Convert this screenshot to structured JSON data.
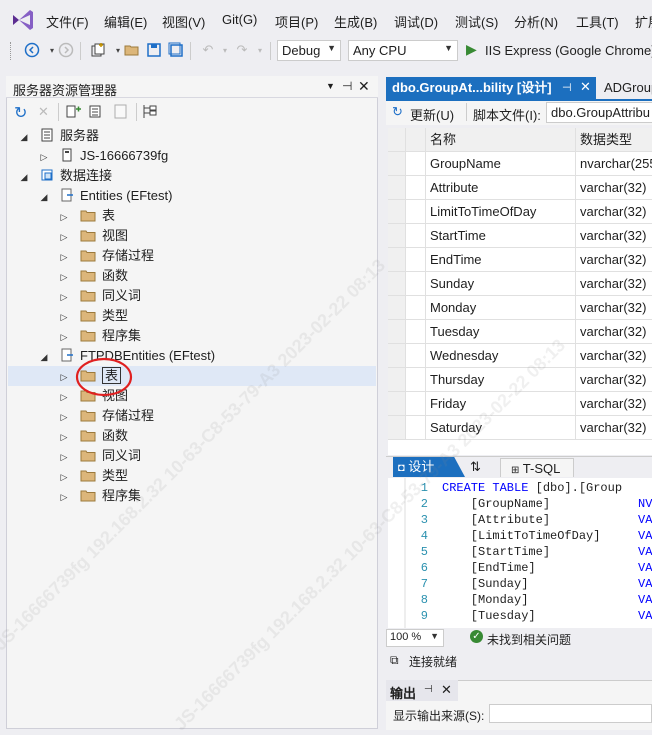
{
  "menu": [
    "文件(F)",
    "编辑(E)",
    "视图(V)",
    "Git(G)",
    "项目(P)",
    "生成(B)",
    "调试(D)",
    "测试(S)",
    "分析(N)",
    "工具(T)",
    "扩展"
  ],
  "toolbar": {
    "config": "Debug",
    "platform": "Any CPU",
    "run_label": "IIS Express (Google Chrome)"
  },
  "server_explorer": {
    "title": "服务器资源管理器",
    "tree": [
      {
        "level": 0,
        "expand": "open",
        "icon": "server",
        "label": "服务器"
      },
      {
        "level": 1,
        "expand": "closed",
        "icon": "computer",
        "label": "JS-16666739fg"
      },
      {
        "level": 0,
        "expand": "open",
        "icon": "database",
        "label": "数据连接"
      },
      {
        "level": 1,
        "expand": "open",
        "icon": "connection",
        "label": "Entities (EFtest)"
      },
      {
        "level": 2,
        "expand": "closed",
        "icon": "folder",
        "label": "表"
      },
      {
        "level": 2,
        "expand": "closed",
        "icon": "folder",
        "label": "视图"
      },
      {
        "level": 2,
        "expand": "closed",
        "icon": "folder",
        "label": "存储过程"
      },
      {
        "level": 2,
        "expand": "closed",
        "icon": "folder",
        "label": "函数"
      },
      {
        "level": 2,
        "expand": "closed",
        "icon": "folder",
        "label": "同义词"
      },
      {
        "level": 2,
        "expand": "closed",
        "icon": "folder",
        "label": "类型"
      },
      {
        "level": 2,
        "expand": "closed",
        "icon": "folder",
        "label": "程序集"
      },
      {
        "level": 1,
        "expand": "open",
        "icon": "connection",
        "label": "FTPDBEntities (EFtest)"
      },
      {
        "level": 2,
        "expand": "closed",
        "icon": "folder",
        "label": "表",
        "selected": true
      },
      {
        "level": 2,
        "expand": "closed",
        "icon": "folder",
        "label": "视图"
      },
      {
        "level": 2,
        "expand": "closed",
        "icon": "folder",
        "label": "存储过程"
      },
      {
        "level": 2,
        "expand": "closed",
        "icon": "folder",
        "label": "函数"
      },
      {
        "level": 2,
        "expand": "closed",
        "icon": "folder",
        "label": "同义词"
      },
      {
        "level": 2,
        "expand": "closed",
        "icon": "folder",
        "label": "类型"
      },
      {
        "level": 2,
        "expand": "closed",
        "icon": "folder",
        "label": "程序集"
      }
    ]
  },
  "tabs": {
    "active": "dbo.GroupAt...bility [设计]",
    "inactive": "ADGroup"
  },
  "designer": {
    "update_label": "更新(U)",
    "script_label": "脚本文件(I):",
    "script_value": "dbo.GroupAttribu",
    "col_name": "名称",
    "col_type": "数据类型",
    "rows": [
      {
        "name": "GroupName",
        "type": "nvarchar(255"
      },
      {
        "name": "Attribute",
        "type": "varchar(32)"
      },
      {
        "name": "LimitToTimeOfDay",
        "type": "varchar(32)"
      },
      {
        "name": "StartTime",
        "type": "varchar(32)"
      },
      {
        "name": "EndTime",
        "type": "varchar(32)"
      },
      {
        "name": "Sunday",
        "type": "varchar(32)"
      },
      {
        "name": "Monday",
        "type": "varchar(32)"
      },
      {
        "name": "Tuesday",
        "type": "varchar(32)"
      },
      {
        "name": "Wednesday",
        "type": "varchar(32)"
      },
      {
        "name": "Thursday",
        "type": "varchar(32)"
      },
      {
        "name": "Friday",
        "type": "varchar(32)"
      },
      {
        "name": "Saturday",
        "type": "varchar(32)"
      }
    ],
    "tab_design": "设计",
    "tab_tsql": "T-SQL",
    "sql_lines": [
      {
        "n": "1",
        "text": "CREATE TABLE [dbo].[Group",
        "kw": true
      },
      {
        "n": "2",
        "text": "    [GroupName]",
        "tail": "NV"
      },
      {
        "n": "3",
        "text": "    [Attribute]",
        "tail": "VA"
      },
      {
        "n": "4",
        "text": "    [LimitToTimeOfDay]",
        "tail": "VA"
      },
      {
        "n": "5",
        "text": "    [StartTime]",
        "tail": "VA"
      },
      {
        "n": "6",
        "text": "    [EndTime]",
        "tail": "VA"
      },
      {
        "n": "7",
        "text": "    [Sunday]",
        "tail": "VA"
      },
      {
        "n": "8",
        "text": "    [Monday]",
        "tail": "VA"
      },
      {
        "n": "9",
        "text": "    [Tuesday]",
        "tail": "VA"
      }
    ],
    "zoom": "100 %",
    "issues": "未找到相关问题"
  },
  "status": {
    "connected": "连接就绪"
  },
  "output": {
    "title": "输出",
    "source_label": "显示输出来源(S):"
  },
  "watermark": "JS-16666739fg 192.168.2.32 10-63-C8-53-79-A3 2023-02-22 08:13"
}
